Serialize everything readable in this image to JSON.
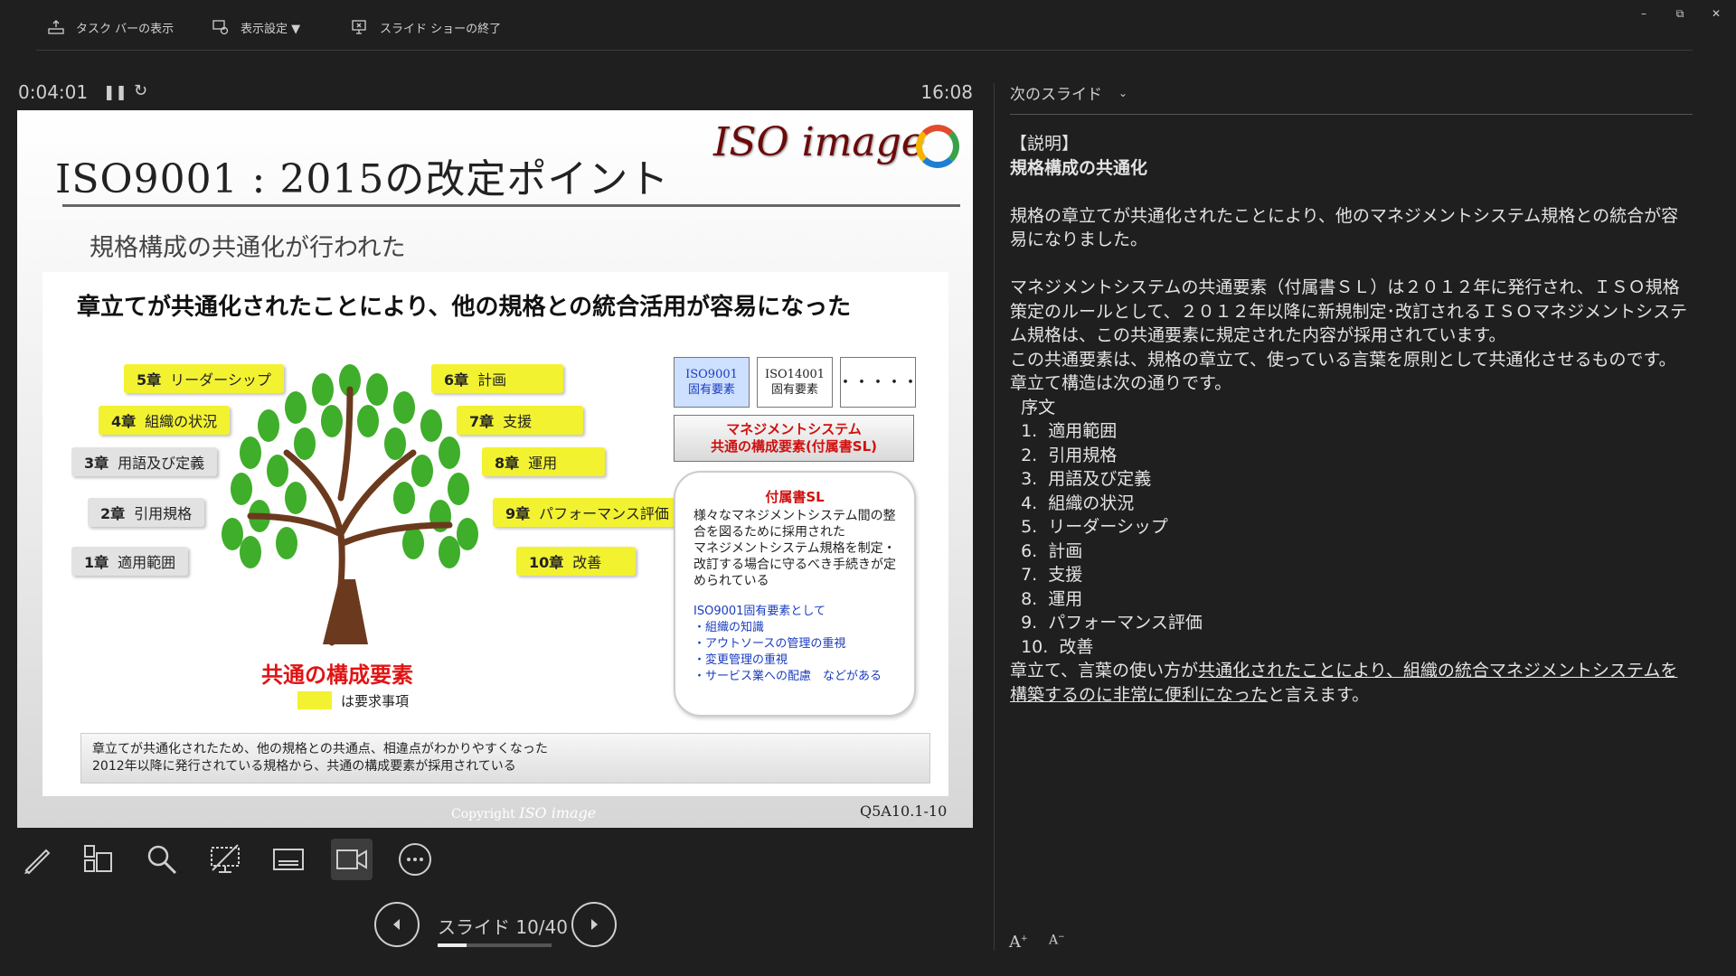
{
  "toolbar": {
    "taskbar_label": "タスク バーの表示",
    "display_label": "表示設定 ▼",
    "end_show_label": "スライド ショーの終了"
  },
  "window": {
    "minimize": "–",
    "restore": "⧉",
    "close": "✕"
  },
  "timer": {
    "elapsed": "0:04:01",
    "clock": "16:08"
  },
  "slide": {
    "title": "ISO9001 : 2015の改定ポイント",
    "logo_text": "ISO image",
    "subtitle": "規格構成の共通化が行われた",
    "headline": "章立てが共通化されたことにより、他の規格との統合活用が容易になった",
    "chapters": [
      {
        "num": "5章",
        "label": "リーダーシップ"
      },
      {
        "num": "4章",
        "label": "組織の状況"
      },
      {
        "num": "3章",
        "label": "用語及び定義"
      },
      {
        "num": "2章",
        "label": "引用規格"
      },
      {
        "num": "1章",
        "label": "適用範囲"
      },
      {
        "num": "6章",
        "label": "計画"
      },
      {
        "num": "7章",
        "label": "支援"
      },
      {
        "num": "8章",
        "label": "運用"
      },
      {
        "num": "9章",
        "label": "パフォーマンス評価"
      },
      {
        "num": "10章",
        "label": "改善"
      }
    ],
    "common_elements": "共通の構成要素",
    "legend": "は要求事項",
    "boxes": {
      "iso9001_1": "ISO9001",
      "iso9001_2": "固有要素",
      "iso14001_1": "ISO14001",
      "iso14001_2": "固有要素",
      "dots": "・・・・・"
    },
    "mgmt_1": "マネジメントシステム",
    "mgmt_2": "共通の構成要素(付属書SL)",
    "annex_title": "付属書SL",
    "annex_body": "様々なマネジメントシステム間の整合を図るために採用された\nマネジメントシステム規格を制定・改訂する場合に守るべき手続きが定められている",
    "annex_blue": "ISO9001固有要素として\n・組織の知識\n・アウトソースの管理の重視\n・変更管理の重視\n・サービス業への配慮　などがある",
    "note_line1": "章立てが共通化されたため、他の規格との共通点、相違点がわかりやすくなった",
    "note_line2": "2012年以降に発行されている規格から、共通の構成要素が採用されている",
    "copyright": "Copyright",
    "copyright_logo": "ISO image",
    "code": "Q5A10.1-10"
  },
  "nav": {
    "slide_count": "スライド 10/40",
    "progress": 0.25
  },
  "tools": [
    "pen-tool",
    "all-slides",
    "zoom",
    "screen-toggle",
    "subtitles",
    "camera",
    "more-options"
  ],
  "pane": {
    "next_label": "次のスライド",
    "notes": {
      "l1": "【説明】",
      "l2": "規格構成の共通化",
      "p1": "規格の章立てが共通化されたことにより、他のマネジメントシステム規格との統合が容易になりました。",
      "p2": "マネジメントシステムの共通要素（付属書ＳＬ）は２０１２年に発行され、ＩＳＯ規格策定のルールとして、２０１２年以降に新規制定･改訂されるＩＳＯマネジメントシステム規格は、この共通要素に規定された内容が採用されています。",
      "p3": "この共通要素は、規格の章立て、使っている言葉を原則として共通化させるものです。",
      "p4": "章立て構造は次の通りです。",
      "list": [
        "  序文",
        "  1.  適用範囲",
        "  2.  引用規格",
        "  3.  用語及び定義",
        "  4.  組織の状況",
        "  5.  リーダーシップ",
        "  6.  計画",
        "  7.  支援",
        "  8.  運用",
        "  9.  パフォーマンス評価",
        "  10.  改善"
      ],
      "end_a": "章立て、言葉の使い方が",
      "end_b": "共通化されたことにより、組織の統合マネジメントシステムを構築するのに非常に便利になった",
      "end_c": "と言えます。"
    },
    "font_up": "A",
    "font_down": "A"
  }
}
